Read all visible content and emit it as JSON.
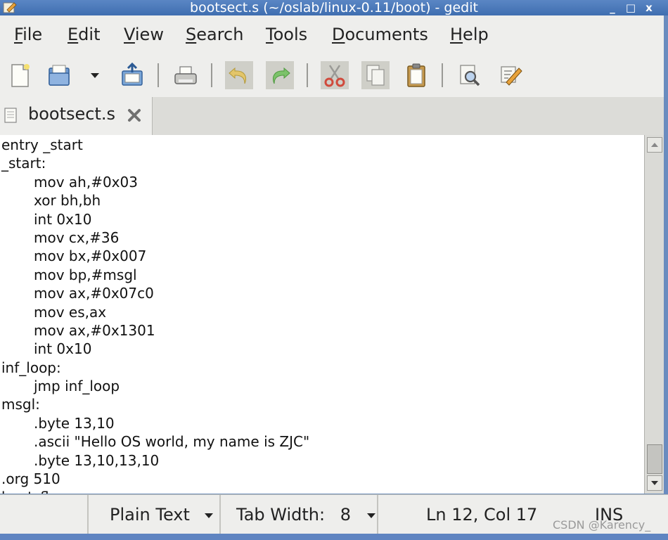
{
  "window": {
    "title": "bootsect.s (~/oslab/linux-0.11/boot) - gedit",
    "controls": [
      "_",
      "□",
      "x"
    ]
  },
  "menu": [
    {
      "label": "File",
      "mnemonic": "F",
      "rest": "ile"
    },
    {
      "label": "Edit",
      "mnemonic": "E",
      "rest": "dit"
    },
    {
      "label": "View",
      "mnemonic": "V",
      "rest": "iew"
    },
    {
      "label": "Search",
      "mnemonic": "S",
      "rest": "earch"
    },
    {
      "label": "Tools",
      "mnemonic": "T",
      "rest": "ools"
    },
    {
      "label": "Documents",
      "mnemonic": "D",
      "rest": "ocuments"
    },
    {
      "label": "Help",
      "mnemonic": "H",
      "rest": "elp"
    }
  ],
  "toolbar": {
    "icons": [
      "new-document-icon",
      "open-icon",
      "open-dropdown-icon",
      "save-icon",
      "print-icon",
      "undo-icon",
      "redo-icon",
      "cut-icon",
      "copy-icon",
      "paste-icon",
      "find-icon",
      "replace-icon"
    ]
  },
  "tab": {
    "label": "bootsect.s",
    "close_icon": "close-icon"
  },
  "editor": {
    "lines": [
      {
        "text": "entry _start",
        "indent": false
      },
      {
        "text": "_start:",
        "indent": false
      },
      {
        "text": "mov ah,#0x03",
        "indent": true
      },
      {
        "text": "xor bh,bh",
        "indent": true
      },
      {
        "text": "int 0x10",
        "indent": true
      },
      {
        "text": "mov cx,#36",
        "indent": true
      },
      {
        "text": "mov bx,#0x007",
        "indent": true
      },
      {
        "text": "mov bp,#msgl",
        "indent": true
      },
      {
        "text": "mov ax,#0x07c0",
        "indent": true
      },
      {
        "text": "mov es,ax",
        "indent": true
      },
      {
        "text": "mov ax,#0x1301",
        "indent": true
      },
      {
        "text": "int 0x10",
        "indent": true
      },
      {
        "text": "inf_loop:",
        "indent": false
      },
      {
        "text": "jmp inf_loop",
        "indent": true
      },
      {
        "text": "msgl:",
        "indent": false
      },
      {
        "text": ".byte 13,10",
        "indent": true
      },
      {
        "text": ".ascii \"Hello OS world, my name is ZJC\"",
        "indent": true
      },
      {
        "text": ".byte 13,10,13,10",
        "indent": true
      },
      {
        "text": ".org 510",
        "indent": false
      },
      {
        "text": "boot_flag:",
        "indent": false
      }
    ]
  },
  "statusbar": {
    "language": "Plain Text",
    "tab_width_label": "Tab Width:",
    "tab_width_value": "8",
    "position": "Ln 12, Col 17",
    "mode": "INS"
  },
  "watermark": "CSDN @Karency_"
}
